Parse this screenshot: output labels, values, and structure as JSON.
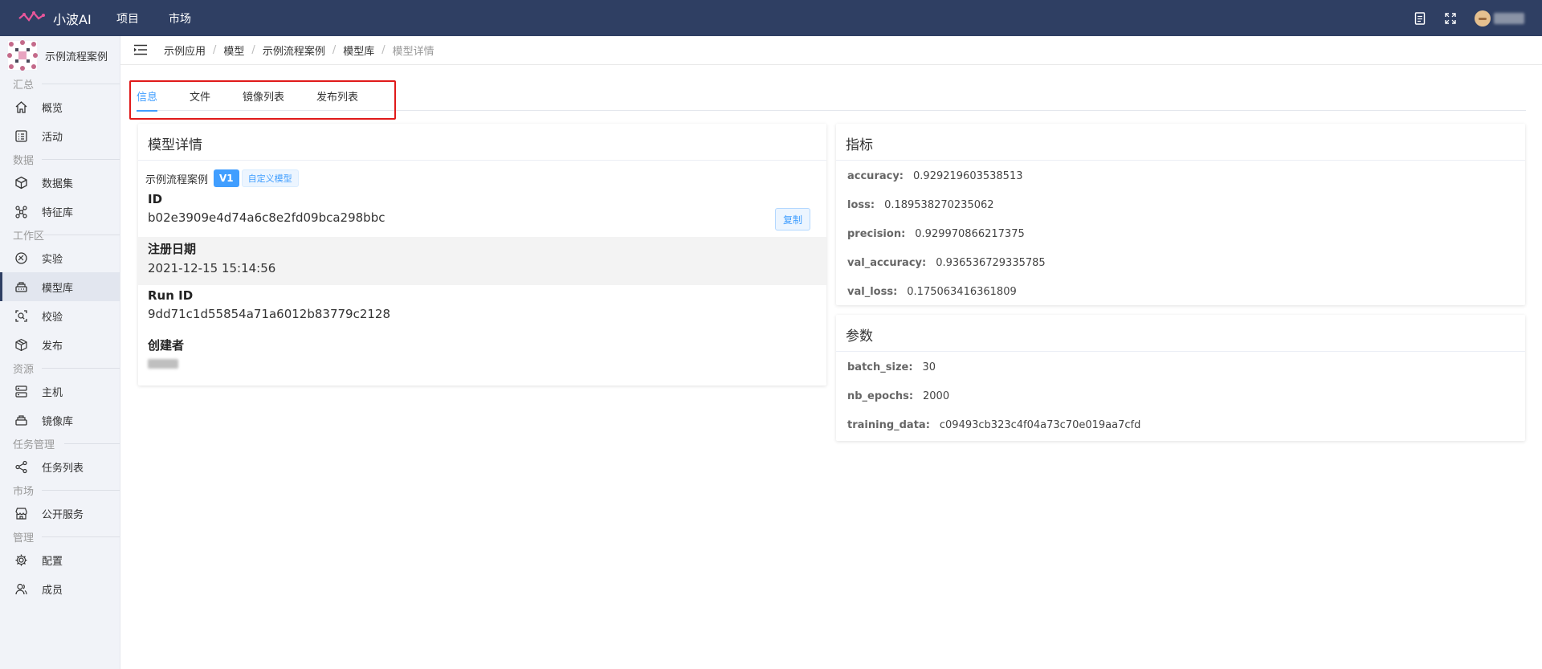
{
  "app": {
    "name": "小波AI"
  },
  "topnav": [
    "项目",
    "市场"
  ],
  "project": {
    "name": "示例流程案例"
  },
  "sidebar": {
    "sections": [
      {
        "title": "汇总",
        "items": [
          {
            "label": "概览",
            "icon": "home-icon"
          },
          {
            "label": "活动",
            "icon": "activity-icon"
          }
        ]
      },
      {
        "title": "数据",
        "items": [
          {
            "label": "数据集",
            "icon": "cube-icon"
          },
          {
            "label": "特征库",
            "icon": "feature-icon"
          }
        ]
      },
      {
        "title": "工作区",
        "items": [
          {
            "label": "实验",
            "icon": "experiment-icon"
          },
          {
            "label": "模型库",
            "icon": "model-icon",
            "active": true
          },
          {
            "label": "校验",
            "icon": "scan-icon"
          },
          {
            "label": "发布",
            "icon": "package-icon"
          }
        ]
      },
      {
        "title": "资源",
        "items": [
          {
            "label": "主机",
            "icon": "server-icon"
          },
          {
            "label": "镜像库",
            "icon": "image-repo-icon"
          }
        ]
      },
      {
        "title": "任务管理",
        "items": [
          {
            "label": "任务列表",
            "icon": "share-icon"
          }
        ]
      },
      {
        "title": "市场",
        "items": [
          {
            "label": "公开服务",
            "icon": "store-icon"
          }
        ]
      },
      {
        "title": "管理",
        "items": [
          {
            "label": "配置",
            "icon": "gear-icon"
          },
          {
            "label": "成员",
            "icon": "members-icon"
          }
        ]
      }
    ]
  },
  "breadcrumb": [
    "示例应用",
    "模型",
    "示例流程案例",
    "模型库",
    "模型详情"
  ],
  "tabs": [
    {
      "label": "信息",
      "active": true
    },
    {
      "label": "文件"
    },
    {
      "label": "镜像列表"
    },
    {
      "label": "发布列表"
    }
  ],
  "detail": {
    "title": "模型详情",
    "project": "示例流程案例",
    "version": "V1",
    "type_tag": "自定义模型",
    "id_label": "ID",
    "id_value": "b02e3909e4d74a6c8e2fd09bca298bbc",
    "copy_label": "复制",
    "date_label": "注册日期",
    "date_value": "2021-12-15 15:14:56",
    "run_label": "Run ID",
    "run_value": "9dd71c1d55854a71a6012b83779c2128",
    "creator_label": "创建者"
  },
  "metrics": {
    "title": "指标",
    "items": [
      {
        "key": "accuracy:",
        "value": "0.929219603538513"
      },
      {
        "key": "loss:",
        "value": "0.189538270235062"
      },
      {
        "key": "precision:",
        "value": "0.929970866217375"
      },
      {
        "key": "val_accuracy:",
        "value": "0.936536729335785"
      },
      {
        "key": "val_loss:",
        "value": "0.175063416361809"
      }
    ]
  },
  "params": {
    "title": "参数",
    "items": [
      {
        "key": "batch_size:",
        "value": "30"
      },
      {
        "key": "nb_epochs:",
        "value": "2000"
      },
      {
        "key": "training_data:",
        "value": "c09493cb323c4f04a73c70e019aa7cfd"
      }
    ]
  },
  "colors": {
    "topbar": "#2f3f63",
    "accent": "#409eff",
    "highlight": "#e01a1a"
  }
}
